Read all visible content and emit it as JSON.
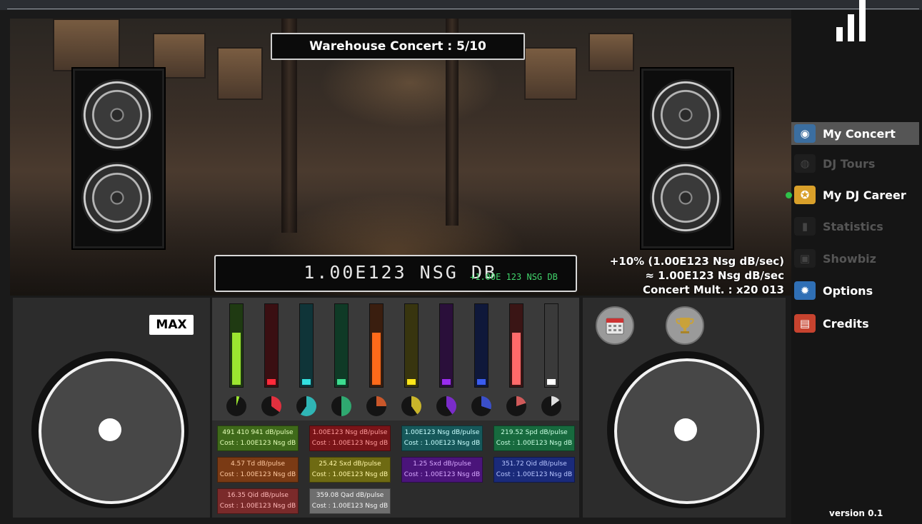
{
  "stage": {
    "title": "Warehouse Concert : 5/10",
    "db_value": "1.00E123 NSG DB",
    "db_float": "+1.00E 123 NSG DB",
    "rate_line1": "+10% (1.00E123 Nsg dB/sec)",
    "rate_line2": "≈ 1.00E123 Nsg dB/sec",
    "rate_line3": "Concert Mult. : x20 013"
  },
  "deck": {
    "max_label": "MAX"
  },
  "faders": [
    {
      "color": "#9be630",
      "level": 0.65
    },
    {
      "color": "#ff2a3a",
      "level": 0.0
    },
    {
      "color": "#33e0e0",
      "level": 0.0
    },
    {
      "color": "#3ddc8f",
      "level": 0.0
    },
    {
      "color": "#ff6a1a",
      "level": 0.65
    },
    {
      "color": "#ffe61a",
      "level": 0.0
    },
    {
      "color": "#9a2cf0",
      "level": 0.0
    },
    {
      "color": "#3a5cf0",
      "level": 0.0
    },
    {
      "color": "#ff6a6a",
      "level": 0.65
    },
    {
      "color": "#ffffff",
      "level": 0.0
    }
  ],
  "fader_tracks": [
    "#1f3a12",
    "#3a0f12",
    "#0f3438",
    "#0f3a26",
    "#3a1e0f",
    "#38350f",
    "#2a0f3a",
    "#0f183a",
    "#3a1515",
    "#3a3a3a"
  ],
  "knobs": [
    {
      "color": "#9be630",
      "fraction": 0.05
    },
    {
      "color": "#e0303e",
      "fraction": 0.35
    },
    {
      "color": "#2fb5b5",
      "fraction": 0.6
    },
    {
      "color": "#2fa870",
      "fraction": 0.5
    },
    {
      "color": "#c9572a",
      "fraction": 0.25
    },
    {
      "color": "#c9b52a",
      "fraction": 0.4
    },
    {
      "color": "#7a2cc9",
      "fraction": 0.4
    },
    {
      "color": "#3a4fc9",
      "fraction": 0.3
    },
    {
      "color": "#d05a5a",
      "fraction": 0.2
    },
    {
      "color": "#dddddd",
      "fraction": 0.15
    }
  ],
  "cards": [
    {
      "line1": "491 410 941  dB/pulse",
      "line2": "Cost : 1.00E123 Nsg dB",
      "bg": "#3f6a1a",
      "fg": "#e4ffb8"
    },
    {
      "line1": "1.00E123 Nsg  dB/pulse",
      "line2": "Cost : 1.00E123 Nsg dB",
      "bg": "#7a1418",
      "fg": "#ff9a9a"
    },
    {
      "line1": "1.00E123 Nsg  dB/pulse",
      "line2": "Cost : 1.00E123 Nsg dB",
      "bg": "#16585a",
      "fg": "#c9ffff"
    },
    {
      "line1": "219.52 Spd  dB/pulse",
      "line2": "Cost : 1.00E123 Nsg dB",
      "bg": "#176a3e",
      "fg": "#c9ffe2"
    },
    {
      "line1": "4.57 Td  dB/pulse",
      "line2": "Cost : 1.00E123 Nsg dB",
      "bg": "#7a3a14",
      "fg": "#ffc9a0"
    },
    {
      "line1": "25.42 Sxd  dB/pulse",
      "line2": "Cost : 1.00E123 Nsg dB",
      "bg": "#6e6a12",
      "fg": "#fff7a8"
    },
    {
      "line1": "1.25 Sxd  dB/pulse",
      "line2": "Cost : 1.00E123 Nsg dB",
      "bg": "#4a147a",
      "fg": "#d8a8ff"
    },
    {
      "line1": "351.72 Qid  dB/pulse",
      "line2": "Cost : 1.00E123 Nsg dB",
      "bg": "#1a2a7a",
      "fg": "#b8c6ff"
    },
    {
      "line1": "16.35 Qid  dB/pulse",
      "line2": "Cost : 1.00E123 Nsg dB",
      "bg": "#7a2a2a",
      "fg": "#ffb8b8"
    },
    {
      "line1": "359.08 Qad  dB/pulse",
      "line2": "Cost : 1.00E123 Nsg dB",
      "bg": "#6e6e6e",
      "fg": "#f4f4f4"
    }
  ],
  "sidebar": {
    "items": [
      {
        "label": "My Concert",
        "icon": "turntable-icon"
      },
      {
        "label": "DJ Tours",
        "icon": "globe-icon"
      },
      {
        "label": "My DJ Career",
        "icon": "medal-icon"
      },
      {
        "label": "Statistics",
        "icon": "bar-chart-icon"
      },
      {
        "label": "Showbiz",
        "icon": "money-stack-icon"
      },
      {
        "label": "Options",
        "icon": "gear-icon"
      },
      {
        "label": "Credits",
        "icon": "book-icon"
      }
    ],
    "version": "version 0.1"
  }
}
